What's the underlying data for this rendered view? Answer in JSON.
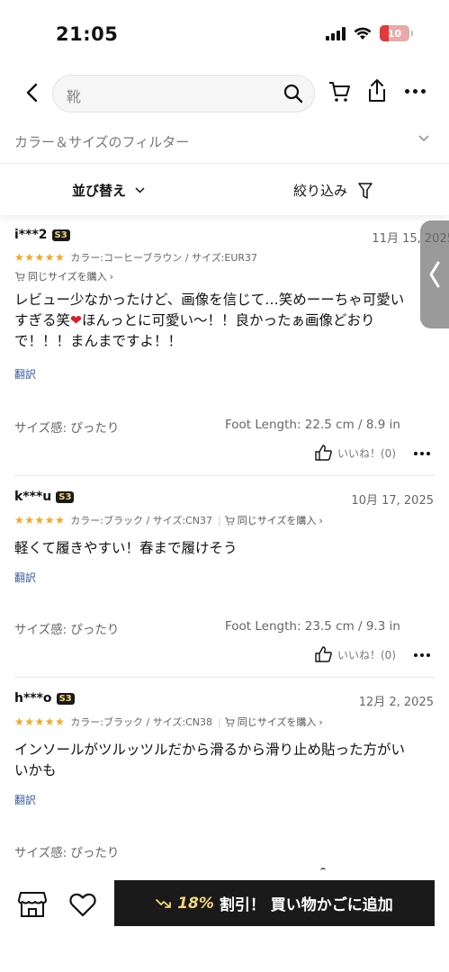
{
  "status": {
    "time": "21:05",
    "battery": "10"
  },
  "search": {
    "query": "靴"
  },
  "filter": {
    "label": "カラー＆サイズのフィルター"
  },
  "sort": {
    "sort_label": "並び替え",
    "narrow_label": "絞り込み"
  },
  "reviews": [
    {
      "user": "i***2",
      "badge": "S3",
      "date": "11月 15, 2025",
      "stars": "★★★★★",
      "attrs": "カラー:コーヒーブラウン / サイズ:EUR37",
      "buy_same": "同じサイズを購入",
      "text_lines": [
        "レビュー少なかったけど、画像を信じて…笑めーーちゃ可愛い",
        "すぎる笑",
        "ほんっとに可愛い〜！！良かったぁ画像どおり",
        "で！！！まんまですよ！！"
      ],
      "translate": "翻訳",
      "fit": "サイズ感: ぴったり",
      "foot": "Foot Length: 22.5 cm / 8.9 in",
      "likes": "いいね！(0)"
    },
    {
      "user": "k***u",
      "badge": "S3",
      "date": "10月 17, 2025",
      "stars": "★★★★★",
      "attrs": "カラー:ブラック / サイズ:CN37",
      "buy_same": "同じサイズを購入",
      "text_lines": [
        "軽くて履きやすい！春まで履けそう"
      ],
      "translate": "翻訳",
      "fit": "サイズ感: ぴったり",
      "foot": "Foot Length: 23.5 cm / 9.3 in",
      "likes": "いいね！(0)"
    },
    {
      "user": "h***o",
      "badge": "S3",
      "date": "12月 2, 2025",
      "stars": "★★★★★",
      "attrs": "カラー:ブラック / サイズ:CN38",
      "buy_same": "同じサイズを購入",
      "text_lines": [
        "インソールがツルッツルだから滑るから滑り止め貼った方がい",
        "いかも"
      ],
      "translate": "翻訳",
      "fit": "サイズ感: ぴったり"
    }
  ],
  "cta": {
    "discount": "18%",
    "label": "割引！ 買い物かごに追加"
  },
  "colors": {
    "star": "#f5a623",
    "badge_bg": "#1a1a1a",
    "badge_text": "#f3d77a",
    "cta_bg": "#1a1a1a",
    "translate": "#3a5da0"
  },
  "icons": [
    "back-icon",
    "search-icon",
    "cart-icon",
    "share-icon",
    "more-icon",
    "chevron-down-icon",
    "filter-icon",
    "thumbs-up-icon",
    "store-icon",
    "heart-icon",
    "trend-down-icon"
  ]
}
